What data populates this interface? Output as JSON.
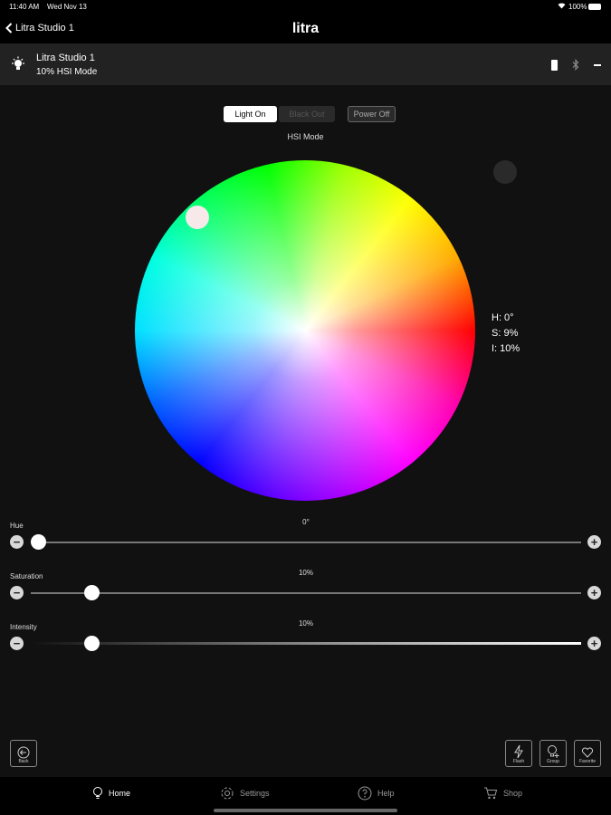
{
  "status": {
    "time": "11:40 AM",
    "date": "Wed Nov 13",
    "battery": "100%"
  },
  "nav": {
    "back_label": "Litra Studio 1",
    "title": "litra"
  },
  "device": {
    "name": "Litra Studio 1",
    "mode_line": "10% HSI Mode"
  },
  "controls": {
    "light_on": "Light On",
    "black_out": "Black Out",
    "power_off": "Power Off",
    "mode_title": "HSI Mode"
  },
  "readout": {
    "h": "H: 0°",
    "s": "S: 9%",
    "i": "I: 10%"
  },
  "sliders": {
    "hue": {
      "label": "Hue",
      "value_text": "0°",
      "value": 0
    },
    "saturation": {
      "label": "Saturation",
      "value_text": "10%",
      "value": 10
    },
    "intensity": {
      "label": "Intensity",
      "value_text": "10%",
      "value": 10
    }
  },
  "actions": {
    "back": "Back",
    "flash": "Flash",
    "group": "Group",
    "favorite": "Favorite"
  },
  "tabs": {
    "home": "Home",
    "settings": "Settings",
    "help": "Help",
    "shop": "Shop"
  },
  "colors": {
    "bg": "#111111",
    "bar": "#222222"
  }
}
